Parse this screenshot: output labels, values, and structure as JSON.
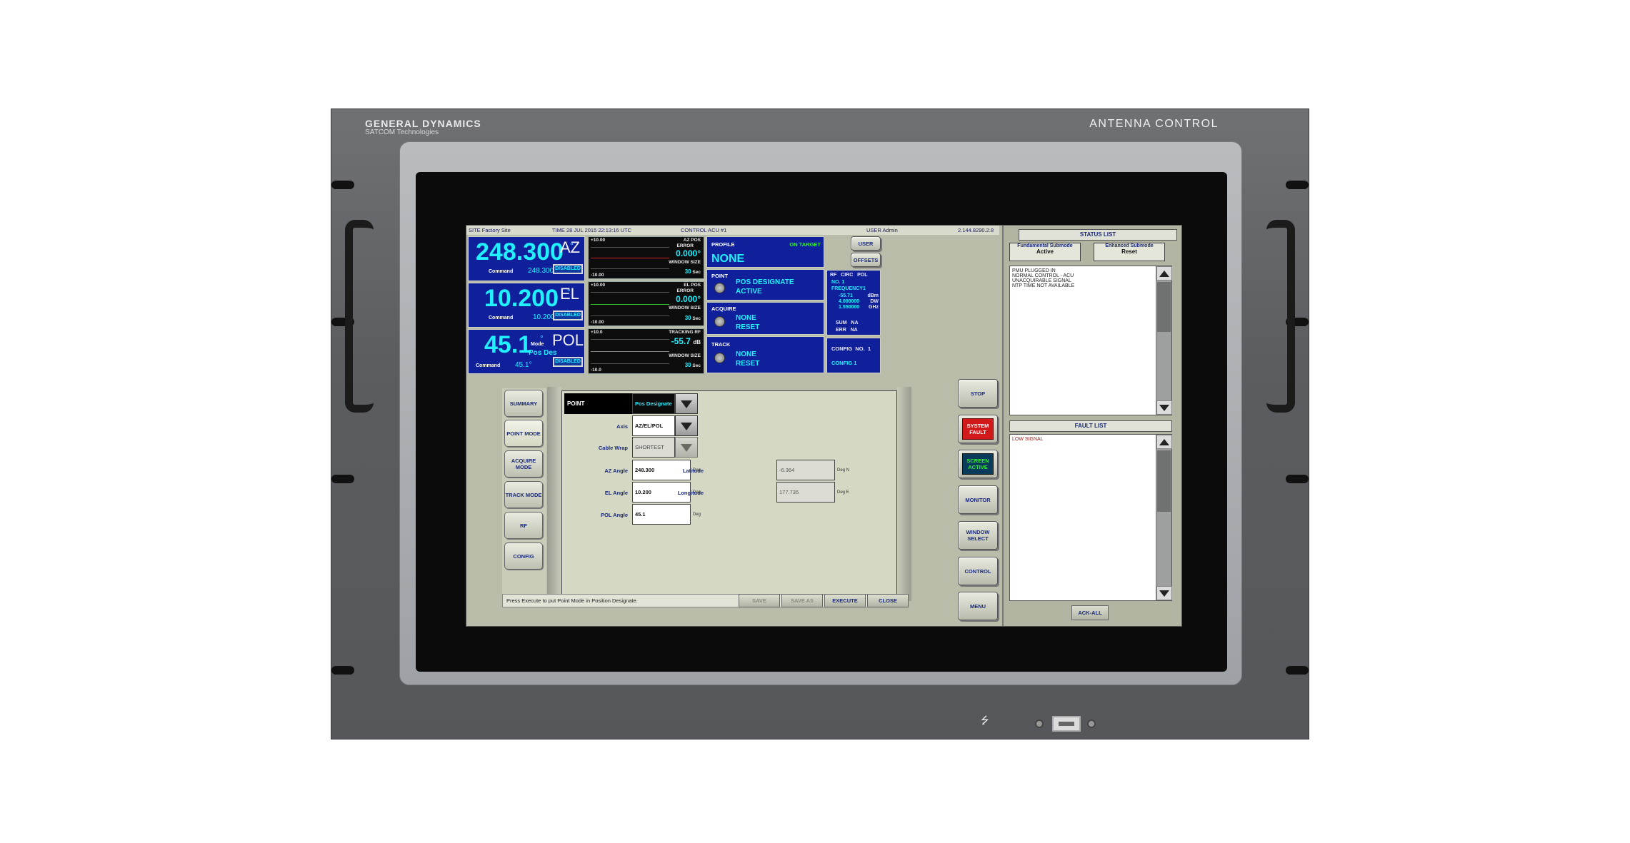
{
  "chassis": {
    "brand_name": "GENERAL DYNAMICS",
    "brand_sub": "SATCOM Technologies",
    "title": "ANTENNA CONTROL",
    "usb_symbol": "⭍"
  },
  "topbar": {
    "site": "SITE Factory Site",
    "time": "TIME  28 JUL 2015 22:13:16  UTC",
    "control": "CONTROL  ACU #1",
    "user": "USER  Admin",
    "version": "2.144.8290.2.8"
  },
  "axes": {
    "az": {
      "value": "248.300",
      "deg": "°",
      "name": "AZ",
      "cmd_label": "Command",
      "cmd_value": "248.300°",
      "status": "DISABLED"
    },
    "el": {
      "value": "10.200",
      "deg": "°",
      "name": "EL",
      "cmd_label": "Command",
      "cmd_value": "10.200°",
      "status": "DISABLED"
    },
    "pol": {
      "value": "45.1",
      "deg": "°",
      "name": "POL",
      "mode_label": "Mode",
      "mode_value": "Pos Des",
      "cmd_label": "Command",
      "cmd_value": "45.1°",
      "status": "DISABLED"
    }
  },
  "plots": {
    "az": {
      "top": "+10.00",
      "bottom": "-10.00",
      "title1": "AZ POS",
      "title2": "ERROR",
      "value": "0.000°",
      "win_label": "WINDOW SIZE",
      "win_value": "30",
      "win_unit": "Sec"
    },
    "el": {
      "top": "+10.00",
      "bottom": "-10.00",
      "title1": "EL POS",
      "title2": "ERROR",
      "value": "0.000°",
      "win_label": "WINDOW SIZE",
      "win_value": "30",
      "win_unit": "Sec"
    },
    "rf": {
      "top": "+10.0",
      "bottom": "-10.0",
      "title1": "TRACKING RF",
      "value": "-55.7",
      "unit": "dB",
      "win_label": "WINDOW SIZE",
      "win_value": "30",
      "win_unit": "Sec"
    }
  },
  "states": {
    "profile": {
      "label": "PROFILE",
      "status": "ON TARGET",
      "value": "NONE"
    },
    "point": {
      "label": "POINT",
      "line1": "POS DESIGNATE",
      "line2": "ACTIVE"
    },
    "acquire": {
      "label": "ACQUIRE",
      "line1": "NONE",
      "line2": "RESET"
    },
    "track": {
      "label": "TRACK",
      "line1": "NONE",
      "line2": "RESET"
    }
  },
  "rf_panel": {
    "header": "RF   CIRC   POL",
    "no": "NO.  1",
    "freq_label": "FREQUENCY1",
    "rows": [
      {
        "value": "-55.71",
        "unit": "dBm"
      },
      {
        "value": "4.000000",
        "unit": "DW"
      },
      {
        "value": "1.550000",
        "unit": "GHz"
      }
    ],
    "sum": "SUM   NA",
    "err": "ERR   NA"
  },
  "config_panel": {
    "line1": "CONFIG  NO.  1",
    "line2": "CONFIG 1"
  },
  "top_buttons": {
    "user": "USER",
    "offsets": "OFFSETS"
  },
  "right_buttons": {
    "stop": "STOP",
    "system_fault": "SYSTEM FAULT",
    "screen_active": "SCREEN ACTIVE",
    "monitor": "MONITOR",
    "window_select": "WINDOW SELECT",
    "control": "CONTROL",
    "menu": "MENU"
  },
  "tabs": [
    "SUMMARY",
    "POINT MODE",
    "ACQUIRE MODE",
    "TRACK MODE",
    "RF",
    "CONFIG"
  ],
  "form": {
    "point_label": "POINT",
    "point_value": "Pos Designate",
    "axis_label": "Axis",
    "axis_value": "AZ/EL/POL",
    "wrap_label": "Cable Wrap",
    "wrap_value": "SHORTEST",
    "az_label": "AZ Angle",
    "az_value": "248.300",
    "el_label": "EL Angle",
    "el_value": "10.200",
    "pol_label": "POL Angle",
    "pol_value": "45.1",
    "unit_deg": "Deg",
    "lat_label": "Latitude",
    "lat_value": "-6.364",
    "lat_unit": "Deg N",
    "lon_label": "Longitude",
    "lon_value": "177.735",
    "lon_unit": "Deg E"
  },
  "footer": {
    "hint": "Press Execute to put Point Mode in Position Designate.",
    "save": "SAVE",
    "save_as": "SAVE AS",
    "execute": "EXECUTE",
    "close": "CLOSE"
  },
  "status_list": {
    "title": "STATUS LIST",
    "fund_label": "Fundamental Submode",
    "fund_value": "Active",
    "enh_label": "Enhanced Submode",
    "enh_value": "Reset",
    "items": [
      "PMU PLUGGED IN",
      "NORMAL CONTROL - ACU",
      "UNACQUIRABLE SIGNAL",
      "NTP TIME NOT AVAILABLE"
    ]
  },
  "fault_list": {
    "title": "FAULT LIST",
    "items": [
      "LOW SIGNAL"
    ],
    "ack_all": "ACK-ALL"
  },
  "colors": {
    "panel_blue": "#10209a",
    "readout_cyan": "#21f0ff",
    "fault_red": "#d21919",
    "fault_text": "#a02020"
  }
}
